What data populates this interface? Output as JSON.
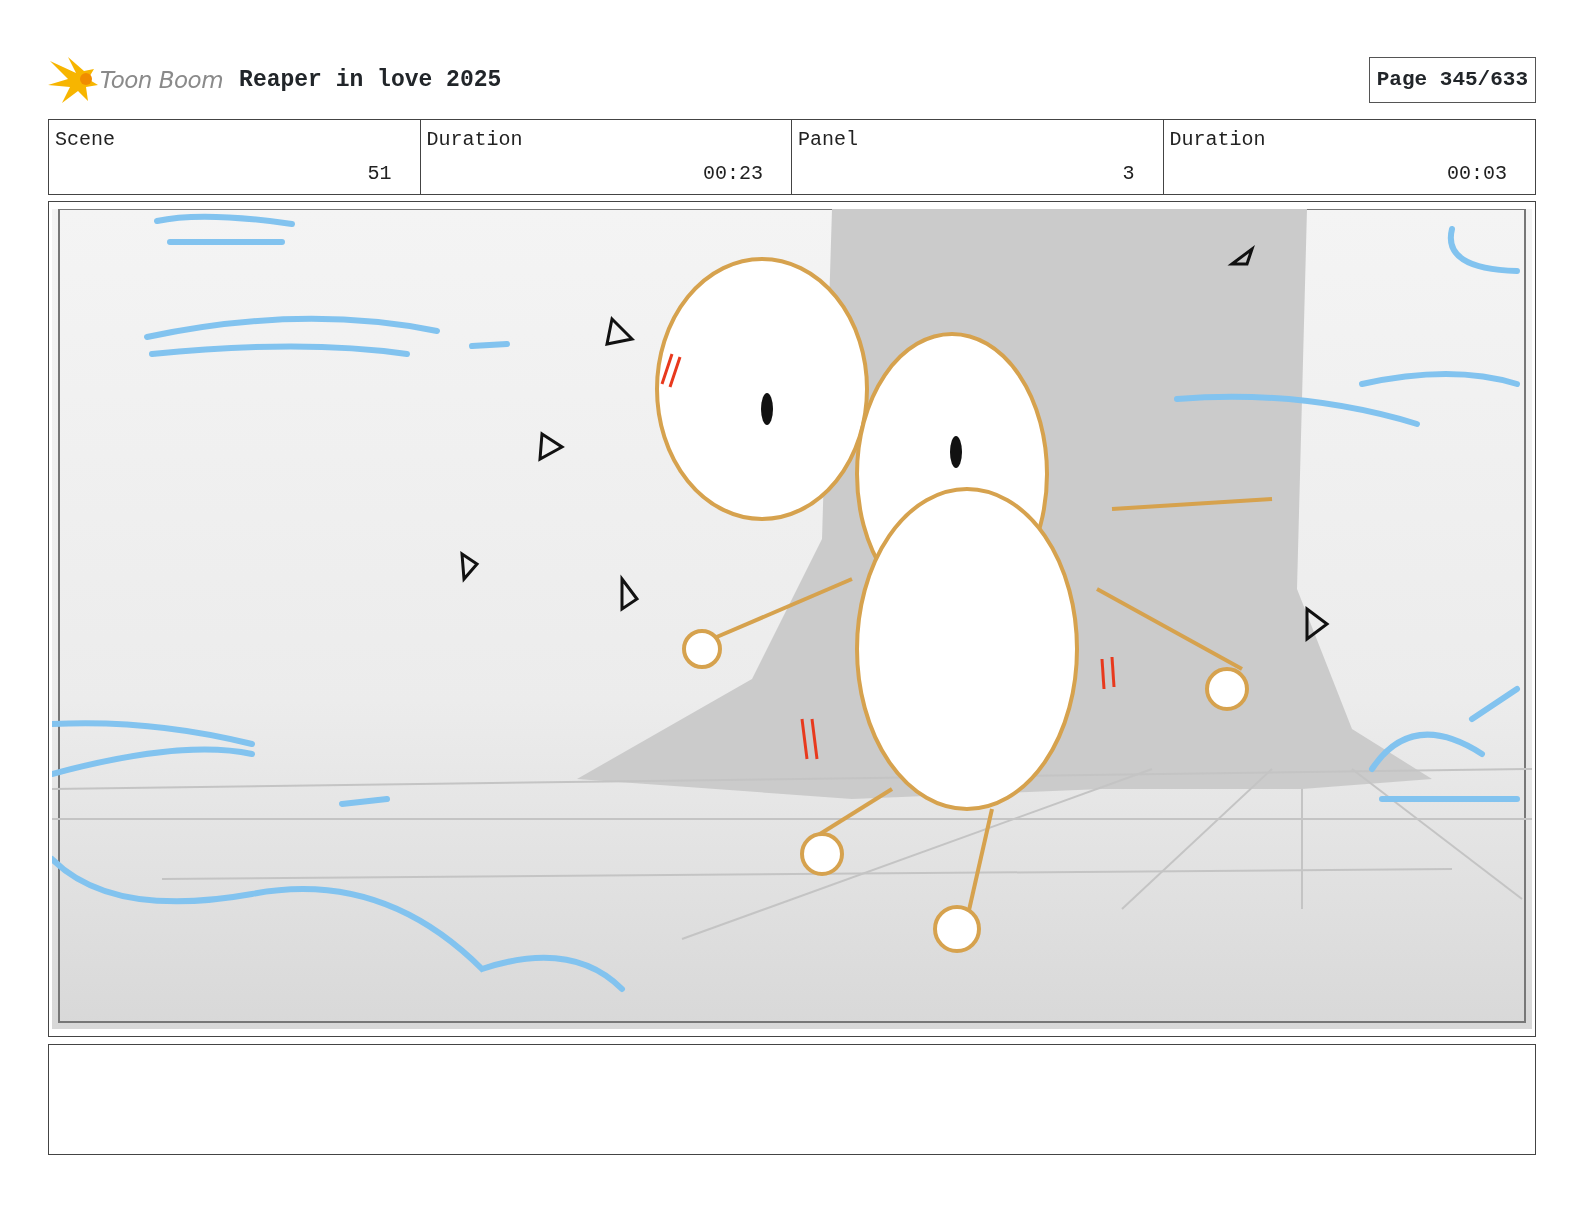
{
  "header": {
    "logo_text": "Toon Boom",
    "title": "Reaper in love 2025",
    "page": "Page 345/633"
  },
  "fields": [
    {
      "label": "Scene",
      "value": "51"
    },
    {
      "label": "Duration",
      "value": "00:23"
    },
    {
      "label": "Panel",
      "value": "3"
    },
    {
      "label": "Duration",
      "value": "00:03"
    }
  ]
}
